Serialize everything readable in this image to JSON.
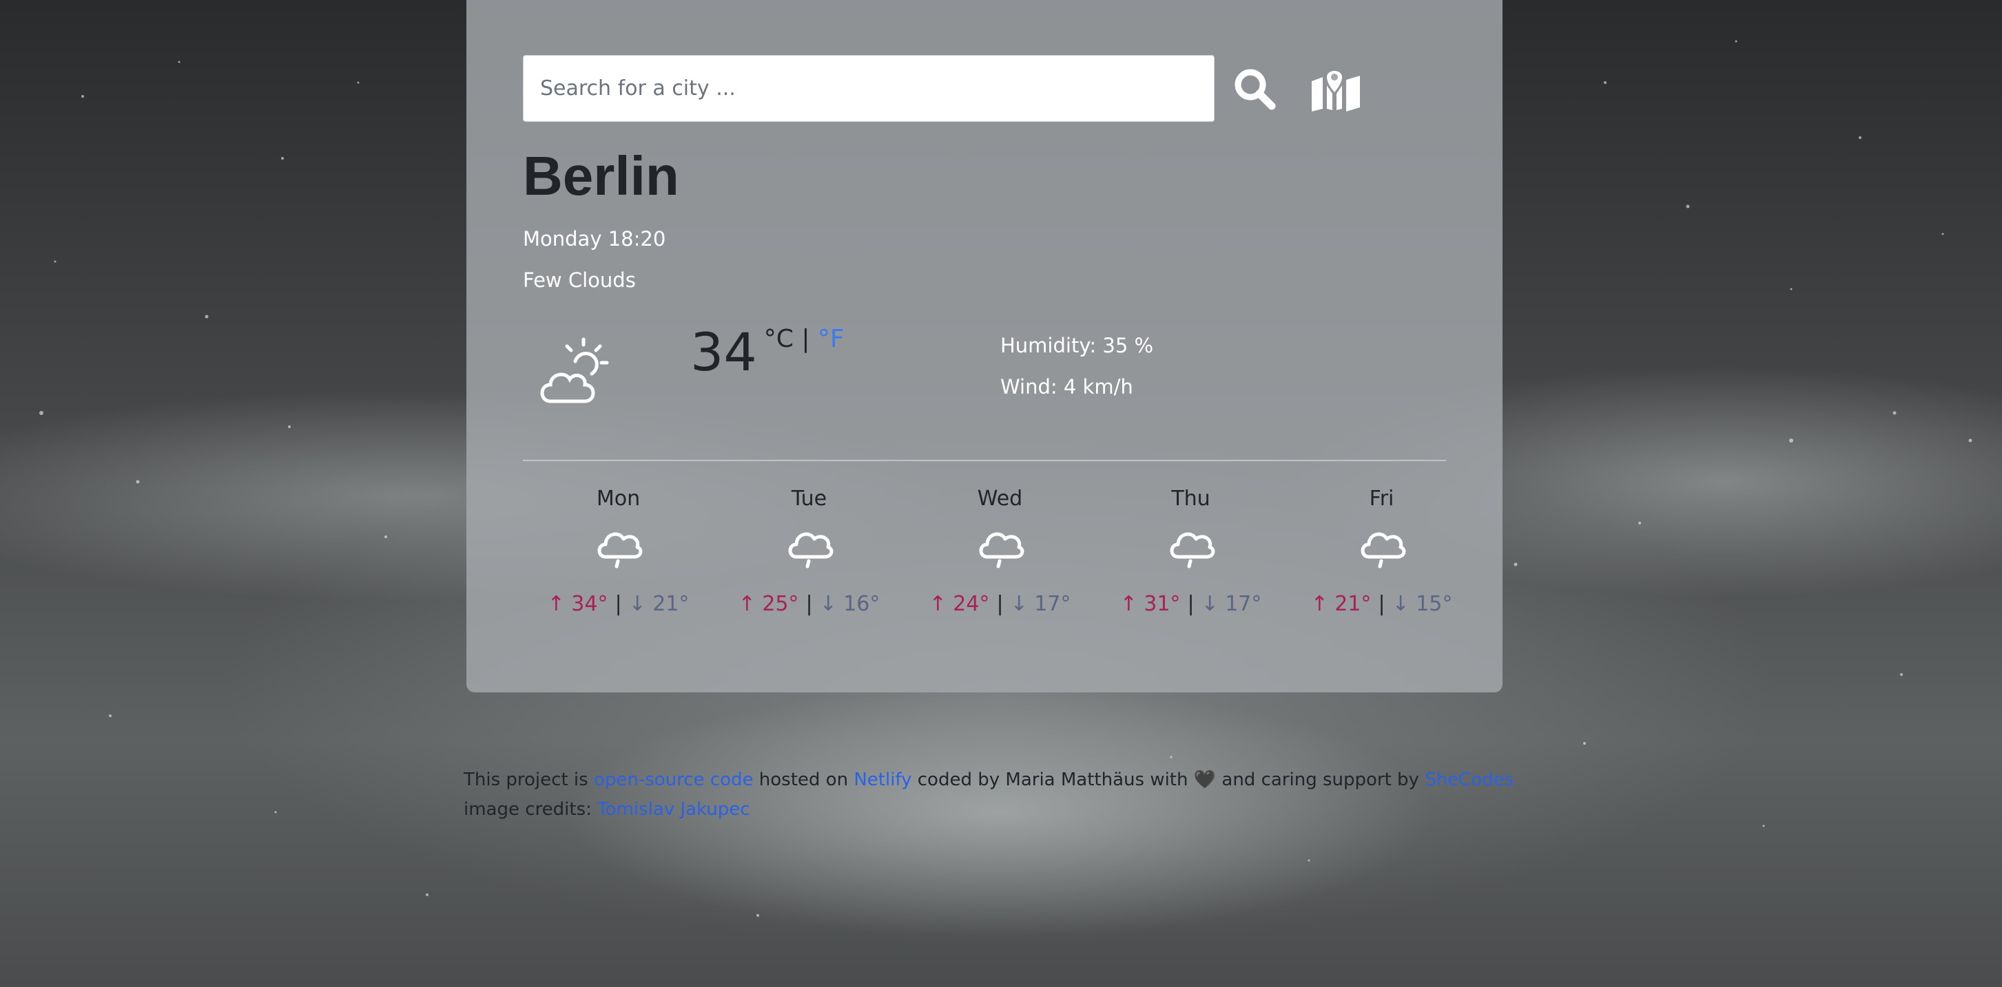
{
  "search": {
    "placeholder": "Search for a city ...",
    "value": ""
  },
  "icons": {
    "search": "search-icon",
    "map": "map-icon",
    "current_weather": "sun-behind-cloud-icon",
    "forecast_weather": "cloud-rain-icon"
  },
  "current": {
    "city": "Berlin",
    "date": "Monday 18:20",
    "description": "Few Clouds",
    "temperature": "34",
    "unit_c": "°C",
    "unit_separator": "|",
    "unit_f": "°F",
    "humidity": "Humidity: 35 %",
    "wind": "Wind: 4 km/h"
  },
  "forecast": [
    {
      "day": "Mon",
      "max": "↑ 34°",
      "min": "↓ 21°"
    },
    {
      "day": "Tue",
      "max": "↑ 25°",
      "min": "↓ 16°"
    },
    {
      "day": "Wed",
      "max": "↑ 24°",
      "min": "↓ 17°"
    },
    {
      "day": "Thu",
      "max": "↑ 31°",
      "min": "↓ 17°"
    },
    {
      "day": "Fri",
      "max": "↑ 21°",
      "min": "↓ 15°"
    }
  ],
  "forecast_separator": "|",
  "footer": {
    "text1": "This project is ",
    "link_code": "open-source code",
    "text2": " hosted on ",
    "link_netlify": "Netlify",
    "text3": " coded by Maria Matthäus with ",
    "heart": "🖤",
    "text4": " and caring support by ",
    "link_shecodes": "SheCodes",
    "credits_label": "image credits: ",
    "link_credits": "Tomislav Jakupec"
  },
  "colors": {
    "accent_link": "#2a62e6",
    "temp_max": "#a8225a",
    "temp_min": "#5b6585",
    "card_bg": "#a5a8ac"
  }
}
